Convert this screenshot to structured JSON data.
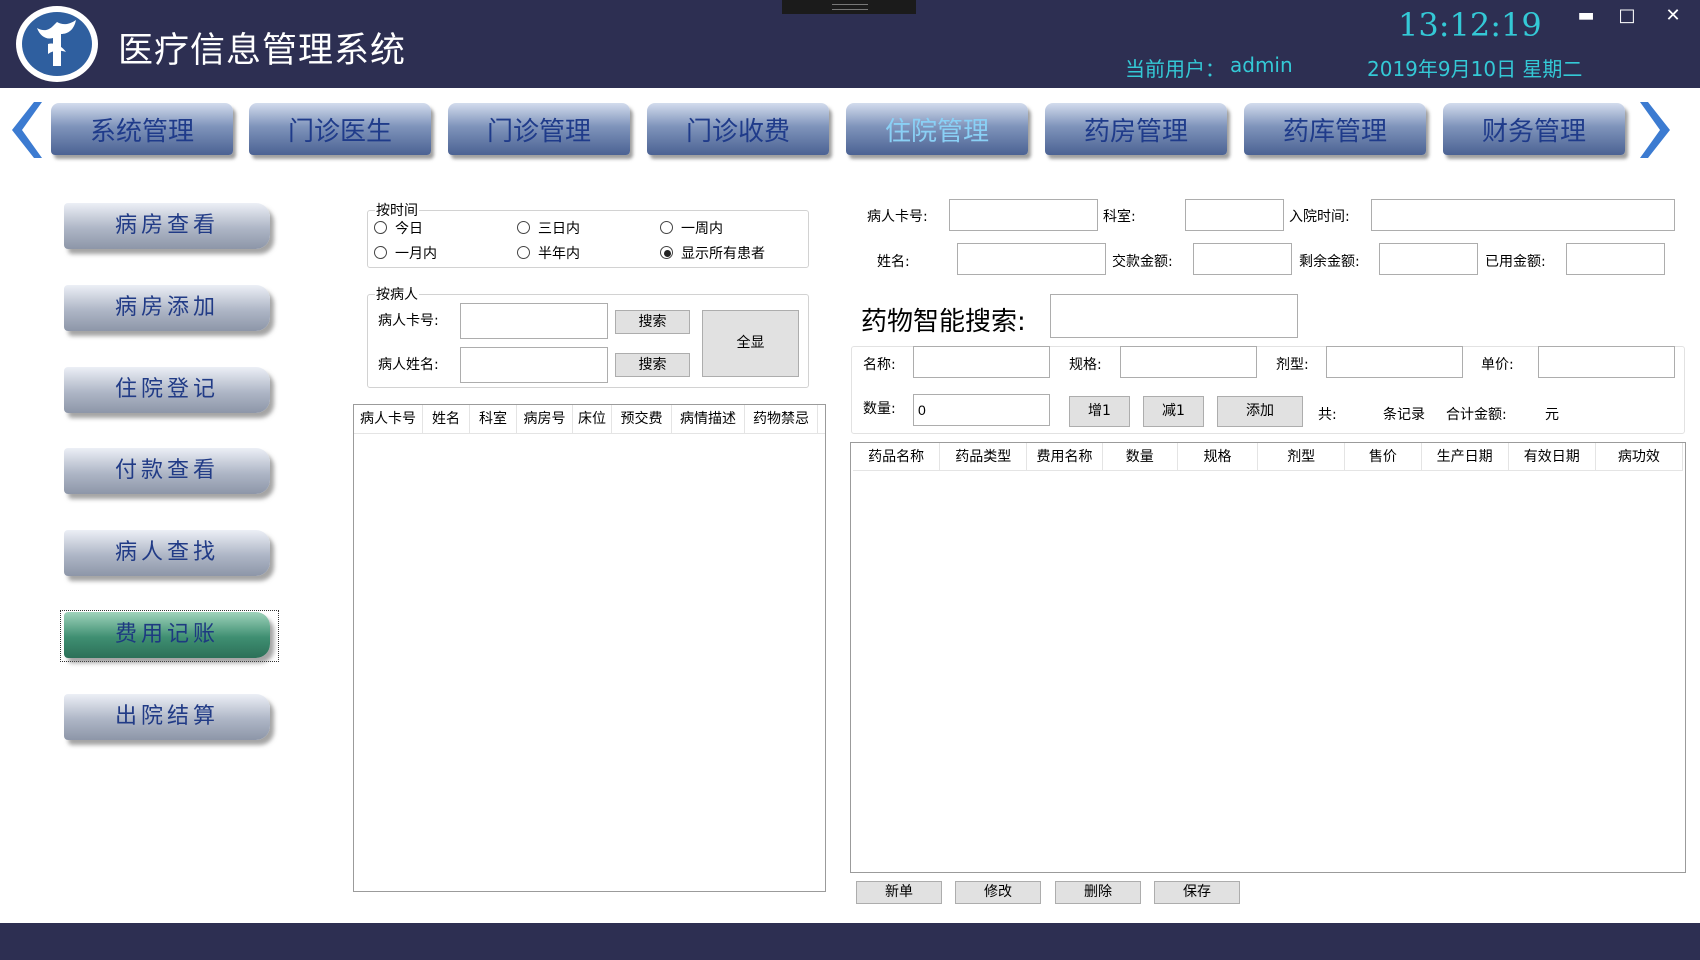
{
  "header": {
    "app_title": "医疗信息管理系统",
    "clock": "13:12:19",
    "user_label": "当前用户：",
    "user_name": "admin",
    "date": "2019年9月10日 星期二",
    "window_buttons": {
      "minimize": "▬",
      "maximize": "□",
      "close": "✕"
    }
  },
  "nav": {
    "tabs": [
      {
        "label": "系统管理"
      },
      {
        "label": "门诊医生"
      },
      {
        "label": "门诊管理"
      },
      {
        "label": "门诊收费"
      },
      {
        "label": "住院管理",
        "active": true
      },
      {
        "label": "药房管理"
      },
      {
        "label": "药库管理"
      },
      {
        "label": "财务管理"
      }
    ],
    "prev_icon": "chevron-left-icon",
    "next_icon": "chevron-right-icon"
  },
  "sidebar": {
    "items": [
      {
        "label": "病房查看"
      },
      {
        "label": "病房添加"
      },
      {
        "label": "住院登记"
      },
      {
        "label": "付款查看"
      },
      {
        "label": "病人查找"
      },
      {
        "label": "费用记账",
        "active": true
      },
      {
        "label": "出院结算"
      }
    ]
  },
  "filter_by_time": {
    "title": "按时间",
    "options": [
      {
        "label": "今日",
        "checked": false
      },
      {
        "label": "三日内",
        "checked": false
      },
      {
        "label": "一周内",
        "checked": false
      },
      {
        "label": "一月内",
        "checked": false
      },
      {
        "label": "半年内",
        "checked": false
      },
      {
        "label": "显示所有患者",
        "checked": true
      }
    ]
  },
  "filter_by_patient": {
    "title": "按病人",
    "card_label": "病人卡号:",
    "name_label": "病人姓名:",
    "card_value": "",
    "name_value": "",
    "search_label": "搜索",
    "show_all_label": "全显"
  },
  "patient_table": {
    "columns": [
      "病人卡号",
      "姓名",
      "科室",
      "病房号",
      "床位",
      "预交费",
      "病情描述",
      "药物禁忌"
    ],
    "rows": []
  },
  "patient_info": {
    "card_label": "病人卡号:",
    "dept_label": "科室:",
    "admit_label": "入院时间:",
    "name_label": "姓名:",
    "paid_label": "交款金额:",
    "remain_label": "剩余金额:",
    "used_label": "已用金额:",
    "card_value": "",
    "dept_value": "",
    "admit_value": "",
    "name_value": "",
    "paid_value": "",
    "remain_value": "",
    "used_value": ""
  },
  "drug_search": {
    "title": "药物智能搜索:",
    "query": "",
    "name_label": "名称:",
    "spec_label": "规格:",
    "form_label": "剂型:",
    "price_label": "单价:",
    "qty_label": "数量:",
    "qty_value": "0",
    "inc_label": "增1",
    "dec_label": "减1",
    "add_label": "添加",
    "total_prefix": "共:",
    "records_suffix": "条记录",
    "sum_label": "合计金额:",
    "currency": "元"
  },
  "drug_table": {
    "columns": [
      "药品名称",
      "药品类型",
      "费用名称",
      "数量",
      "规格",
      "剂型",
      "售价",
      "生产日期",
      "有效日期",
      "病功效"
    ],
    "rows": []
  },
  "actions": {
    "new_label": "新单",
    "edit_label": "修改",
    "delete_label": "删除",
    "save_label": "保存"
  },
  "colors": {
    "header_bg": "#2d2f52",
    "accent_cyan": "#34c9d6",
    "nav_text": "#1f3b8a",
    "nav_active_text": "#8ad0f5",
    "side_active": "#3f8f72"
  }
}
